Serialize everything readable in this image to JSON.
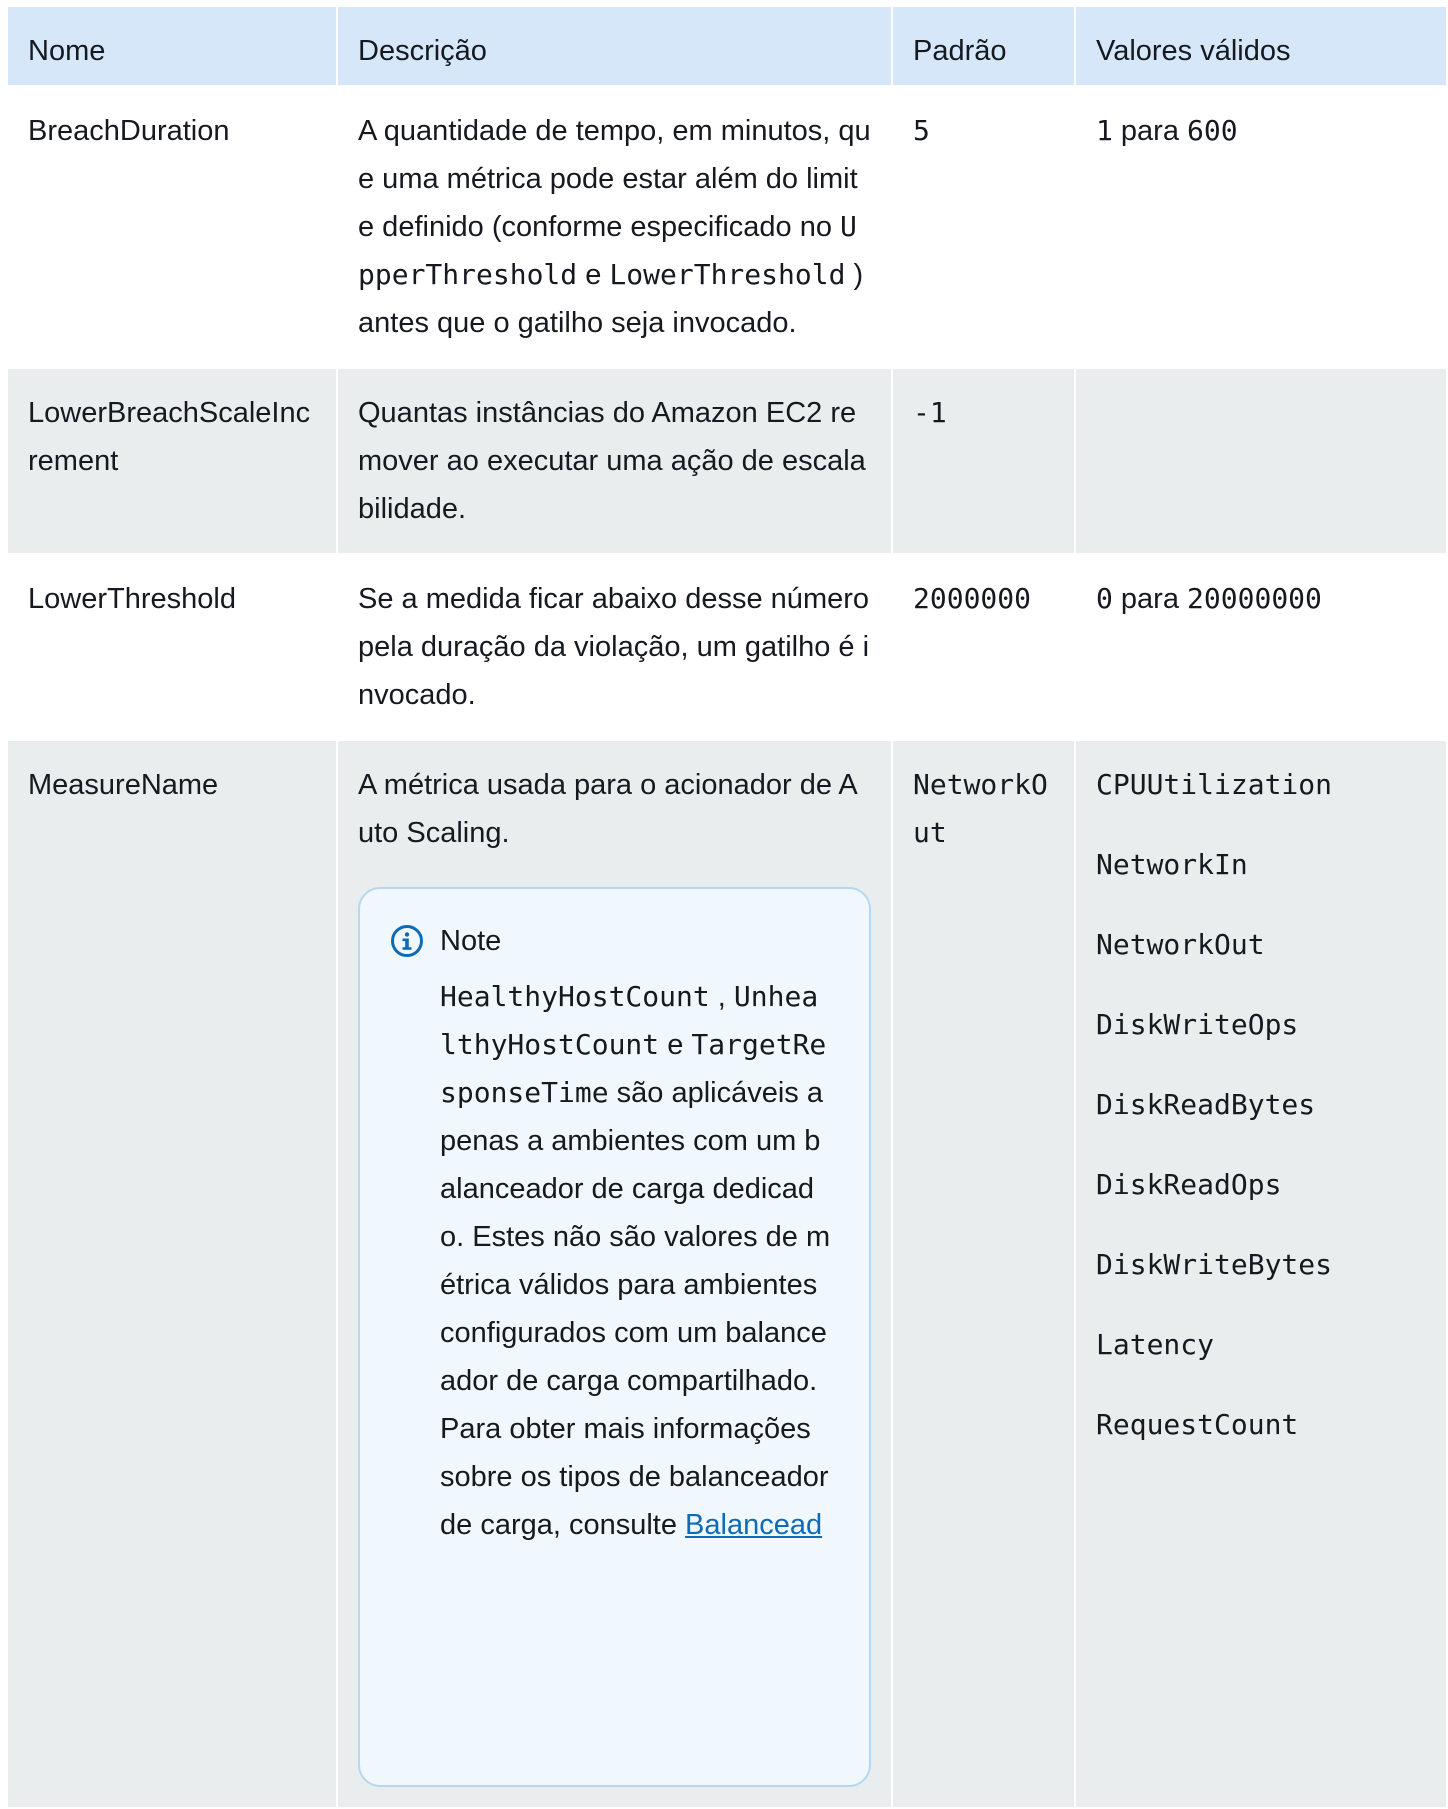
{
  "columns": [
    "Nome",
    "Descrição",
    "Padrão",
    "Valores válidos"
  ],
  "rows": [
    {
      "name": "BreachDuration",
      "desc_a": "A quantidade de tempo, em minutos, que uma métrica pode estar além do limite definido (conforme especificado no",
      "desc_code1": "UpperThreshold",
      "desc_b": "e",
      "desc_code2": "LowerThreshold",
      "desc_c": ") antes que o gatilho seja invocado.",
      "default": "5",
      "valid_from": "1",
      "valid_sep": "para",
      "valid_to": "600"
    },
    {
      "name": "LowerBreachScaleIncrement",
      "desc": "Quantas instâncias do Amazon EC2 remover ao executar uma ação de escalabilidade.",
      "default": "-1",
      "valid": ""
    },
    {
      "name": "LowerThreshold",
      "desc": "Se a medida ficar abaixo desse número pela duração da violação, um gatilho é invocado.",
      "default": "2000000",
      "valid_from": "0",
      "valid_sep": "para",
      "valid_to": "20000000"
    },
    {
      "name": "MeasureName",
      "desc": "A métrica usada para o acionador de Auto Scaling.",
      "default": "NetworkOut",
      "valid_values": [
        "CPUUtilization",
        "NetworkIn",
        "NetworkOut",
        "DiskWriteOps",
        "DiskReadBytes",
        "DiskReadOps",
        "DiskWriteBytes",
        "Latency",
        "RequestCount"
      ],
      "note": {
        "title": "Note",
        "code1": "HealthyHostCount",
        "sep1": ",",
        "code2": "UnhealthyHostCount",
        "sep2": "e",
        "code3": "TargetResponseTime",
        "text": "são aplicáveis apenas a ambientes com um balanceador de carga dedicado. Estes não são valores de métrica válidos para ambientes configurados com um balanceador de carga compartilhado. Para obter mais informações sobre os tipos de balanceador de carga, consulte",
        "link": "Balancead"
      }
    }
  ]
}
